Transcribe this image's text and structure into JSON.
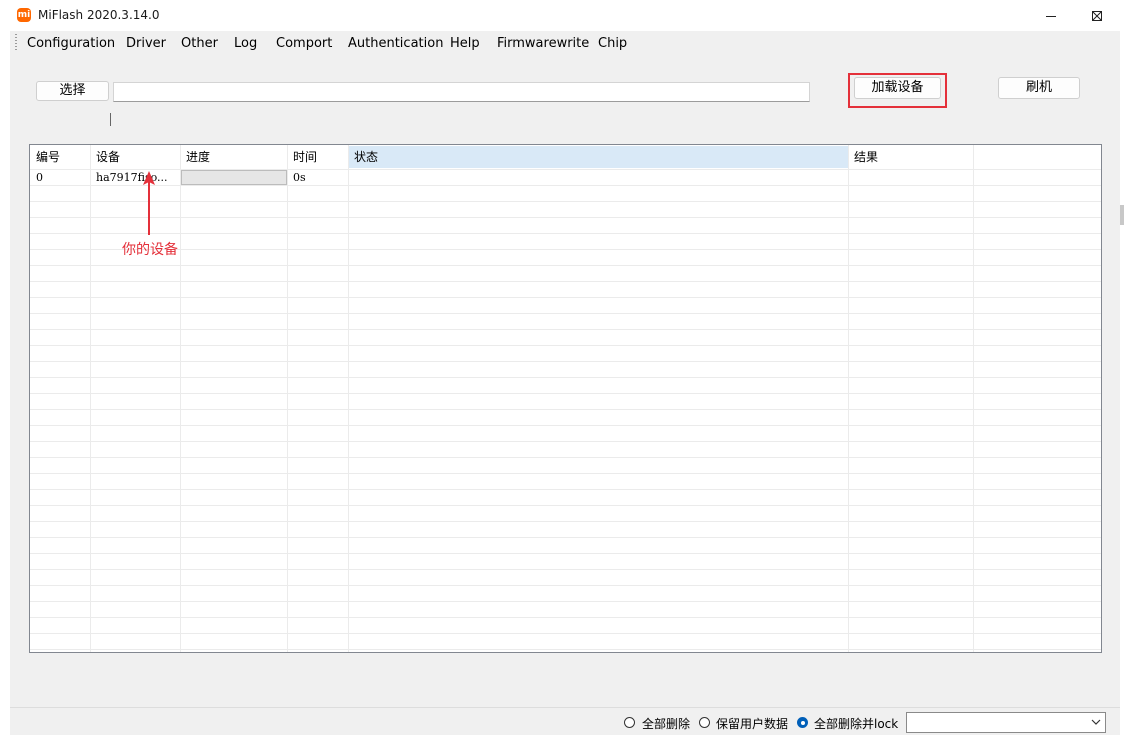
{
  "window": {
    "title": "MiFlash 2020.3.14.0",
    "icon_text": "mi",
    "accent": "#ff6700"
  },
  "menu": [
    {
      "label": "Configuration"
    },
    {
      "label": "Driver"
    },
    {
      "label": "Other"
    },
    {
      "label": "Log"
    },
    {
      "label": "Comport"
    },
    {
      "label": "Authentication"
    },
    {
      "label": "Help"
    },
    {
      "label": "Firmwarewrite"
    },
    {
      "label": "Chip"
    }
  ],
  "toolbar": {
    "select_label": "选择",
    "path_value": "",
    "load_device_label": "加载设备",
    "flash_label": "刷机",
    "highlight_color": "#e4303a"
  },
  "table": {
    "columns": [
      "编号",
      "设备",
      "进度",
      "时间",
      "状态",
      "结果"
    ],
    "selected_column": "状态",
    "rows": [
      {
        "id": "0",
        "device": "ha7917fiso...",
        "progress": 0,
        "time": "0s",
        "status": "",
        "result": ""
      }
    ]
  },
  "annotation": {
    "text": "你的设备",
    "color": "#e4303a"
  },
  "bottom": {
    "options": [
      {
        "label": "全部删除",
        "checked": false
      },
      {
        "label": "保留用户数据",
        "checked": false
      },
      {
        "label": "全部删除并lock",
        "checked": true
      }
    ],
    "combo_value": ""
  }
}
